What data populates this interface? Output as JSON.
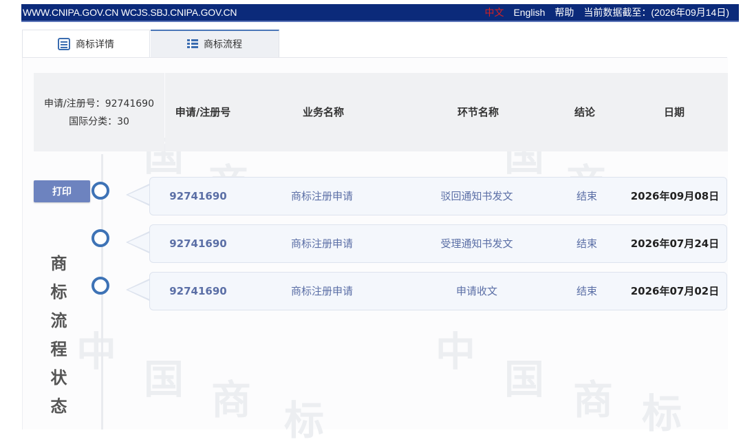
{
  "topbar": {
    "sites": "WWW.CNIPA.GOV.CN WCJS.SBJ.CNIPA.GOV.CN",
    "lang_zh": "中文",
    "lang_en": "English",
    "help": "帮助",
    "data_cutoff": "当前数据截至：(2026年09月14日)"
  },
  "tabs": [
    {
      "label": "商标详情",
      "icon": "document-icon"
    },
    {
      "label": "商标流程",
      "icon": "list-icon"
    }
  ],
  "info": {
    "reg_no_line": "申请/注册号：92741690",
    "class_line": "国际分类：30"
  },
  "columns": [
    "申请/注册号",
    "业务名称",
    "环节名称",
    "结论",
    "日期"
  ],
  "print_label": "打印",
  "side_title": "商标流程状态",
  "rows": [
    {
      "reg_no": "92741690",
      "business": "商标注册申请",
      "step": "驳回通知书发文",
      "result": "结束",
      "date": "2026年09月08日"
    },
    {
      "reg_no": "92741690",
      "business": "商标注册申请",
      "step": "受理通知书发文",
      "result": "结束",
      "date": "2026年07月24日"
    },
    {
      "reg_no": "92741690",
      "business": "商标注册申请",
      "step": "申请收文",
      "result": "结束",
      "date": "2026年07月02日"
    }
  ],
  "colors": {
    "topbar_bg": "#0b2a7a",
    "accent": "#3e73b6",
    "button": "#6d83bf"
  }
}
